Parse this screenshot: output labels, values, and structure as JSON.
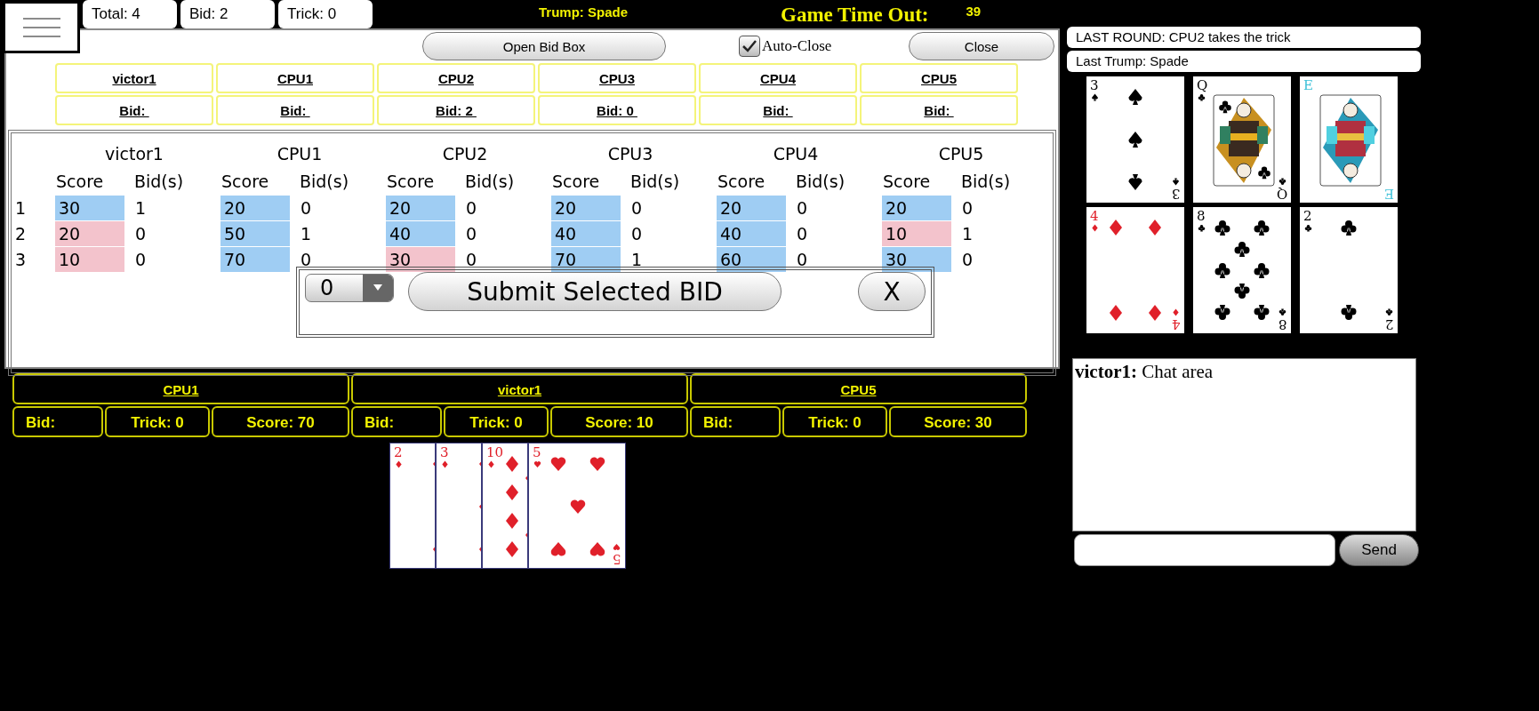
{
  "header": {
    "stats": [
      "Total: 4",
      "Bid: 2",
      "Trick: 0"
    ],
    "trump": "Trump: Spade",
    "timer_label": "Game Time Out:",
    "timer_value": "39"
  },
  "bid_panel": {
    "open_button": "Open Bid Box",
    "auto_close": {
      "label": "Auto-Close",
      "checked": true
    },
    "close_button": "Close",
    "players": [
      {
        "name": "victor1",
        "bid": "Bid:"
      },
      {
        "name": "CPU1",
        "bid": "Bid:"
      },
      {
        "name": "CPU2",
        "bid": "Bid: 2"
      },
      {
        "name": "CPU3",
        "bid": "Bid: 0"
      },
      {
        "name": "CPU4",
        "bid": "Bid:"
      },
      {
        "name": "CPU5",
        "bid": "Bid:"
      }
    ]
  },
  "scoreboard": {
    "row_numbers": [
      "1",
      "2",
      "3"
    ],
    "players": [
      {
        "name": "victor1",
        "score_label": "Score",
        "bids_label": "Bid(s)",
        "rows": [
          {
            "score": "30",
            "bid": "1",
            "made": true
          },
          {
            "score": "20",
            "bid": "0",
            "made": false
          },
          {
            "score": "10",
            "bid": "0",
            "made": false
          }
        ]
      },
      {
        "name": "CPU1",
        "score_label": "Score",
        "bids_label": "Bid(s)",
        "rows": [
          {
            "score": "20",
            "bid": "0",
            "made": true
          },
          {
            "score": "50",
            "bid": "1",
            "made": true
          },
          {
            "score": "70",
            "bid": "0",
            "made": true
          }
        ]
      },
      {
        "name": "CPU2",
        "score_label": "Score",
        "bids_label": "Bid(s)",
        "rows": [
          {
            "score": "20",
            "bid": "0",
            "made": true
          },
          {
            "score": "40",
            "bid": "0",
            "made": true
          },
          {
            "score": "30",
            "bid": "0",
            "made": false
          }
        ]
      },
      {
        "name": "CPU3",
        "score_label": "Score",
        "bids_label": "Bid(s)",
        "rows": [
          {
            "score": "20",
            "bid": "0",
            "made": true
          },
          {
            "score": "40",
            "bid": "0",
            "made": true
          },
          {
            "score": "70",
            "bid": "1",
            "made": true
          }
        ]
      },
      {
        "name": "CPU4",
        "score_label": "Score",
        "bids_label": "Bid(s)",
        "rows": [
          {
            "score": "20",
            "bid": "0",
            "made": true
          },
          {
            "score": "40",
            "bid": "0",
            "made": true
          },
          {
            "score": "60",
            "bid": "0",
            "made": true
          }
        ]
      },
      {
        "name": "CPU5",
        "score_label": "Score",
        "bids_label": "Bid(s)",
        "rows": [
          {
            "score": "20",
            "bid": "0",
            "made": true
          },
          {
            "score": "10",
            "bid": "1",
            "made": false
          },
          {
            "score": "30",
            "bid": "0",
            "made": true
          }
        ]
      }
    ],
    "bid_select": {
      "value": "0"
    },
    "submit_button": "Submit Selected BID",
    "cancel_button": "X"
  },
  "seats": [
    {
      "name": "CPU1",
      "bid": "Bid:",
      "trick": "Trick: 0",
      "score": "Score: 70"
    },
    {
      "name": "victor1",
      "bid": "Bid:",
      "trick": "Trick: 0",
      "score": "Score: 10"
    },
    {
      "name": "CPU5",
      "bid": "Bid:",
      "trick": "Trick: 0",
      "score": "Score: 30"
    }
  ],
  "hand": [
    {
      "kind": "diamond",
      "rank": "2"
    },
    {
      "kind": "diamond",
      "rank": "3"
    },
    {
      "kind": "diamond",
      "rank": "10"
    },
    {
      "kind": "heart",
      "rank": "5",
      "rank_rotated": "5"
    }
  ],
  "last_round": "LAST ROUND: CPU2 takes the trick",
  "last_trump": "Last Trump: Spade",
  "trick_cards": [
    {
      "kind": "spade",
      "rank": "3",
      "rank_rotated": "3"
    },
    {
      "kind": "club",
      "face": true,
      "rank": "Q",
      "rank_rotated": "Q"
    },
    {
      "kind": "joker",
      "face": true,
      "rank": "E",
      "rank_rotated": "E"
    },
    {
      "kind": "diamond",
      "rank": "4",
      "rank_rotated": "4"
    },
    {
      "kind": "club",
      "rank": "8",
      "rank_rotated": "8"
    },
    {
      "kind": "club",
      "rank": "2",
      "rank_rotated": "2"
    }
  ],
  "chat": {
    "messages": [
      "**victor1:** Chat area"
    ],
    "send_button": "Send"
  }
}
